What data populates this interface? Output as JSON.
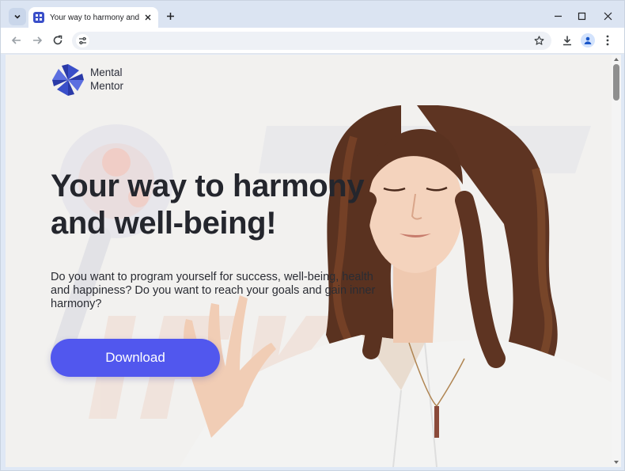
{
  "browser": {
    "tab_title": "Your way to harmony and well-b",
    "url": "",
    "accent": "#3a4fc9"
  },
  "icons": {
    "tab_search": "chevron-down-icon",
    "close": "close-icon",
    "new_tab": "plus-icon",
    "minimize": "minimize-icon",
    "maximize": "maximize-icon",
    "window_close": "close-icon",
    "back": "arrow-left-icon",
    "forward": "arrow-right-icon",
    "reload": "reload-icon",
    "site_info": "tune-icon",
    "bookmark": "star-icon",
    "download": "download-icon",
    "profile": "person-icon",
    "menu": "kebab-menu-icon"
  },
  "page": {
    "brand_line1": "Mental",
    "brand_line2": "Mentor",
    "headline_line1": "Your way to harmony",
    "headline_line2": "and well-being!",
    "subtext": "Do you want to program yourself for success, well-being, health and happiness? Do you want to reach your goals and gain inner harmony?",
    "cta_label": "Download",
    "cta_color": "#5157ee"
  }
}
